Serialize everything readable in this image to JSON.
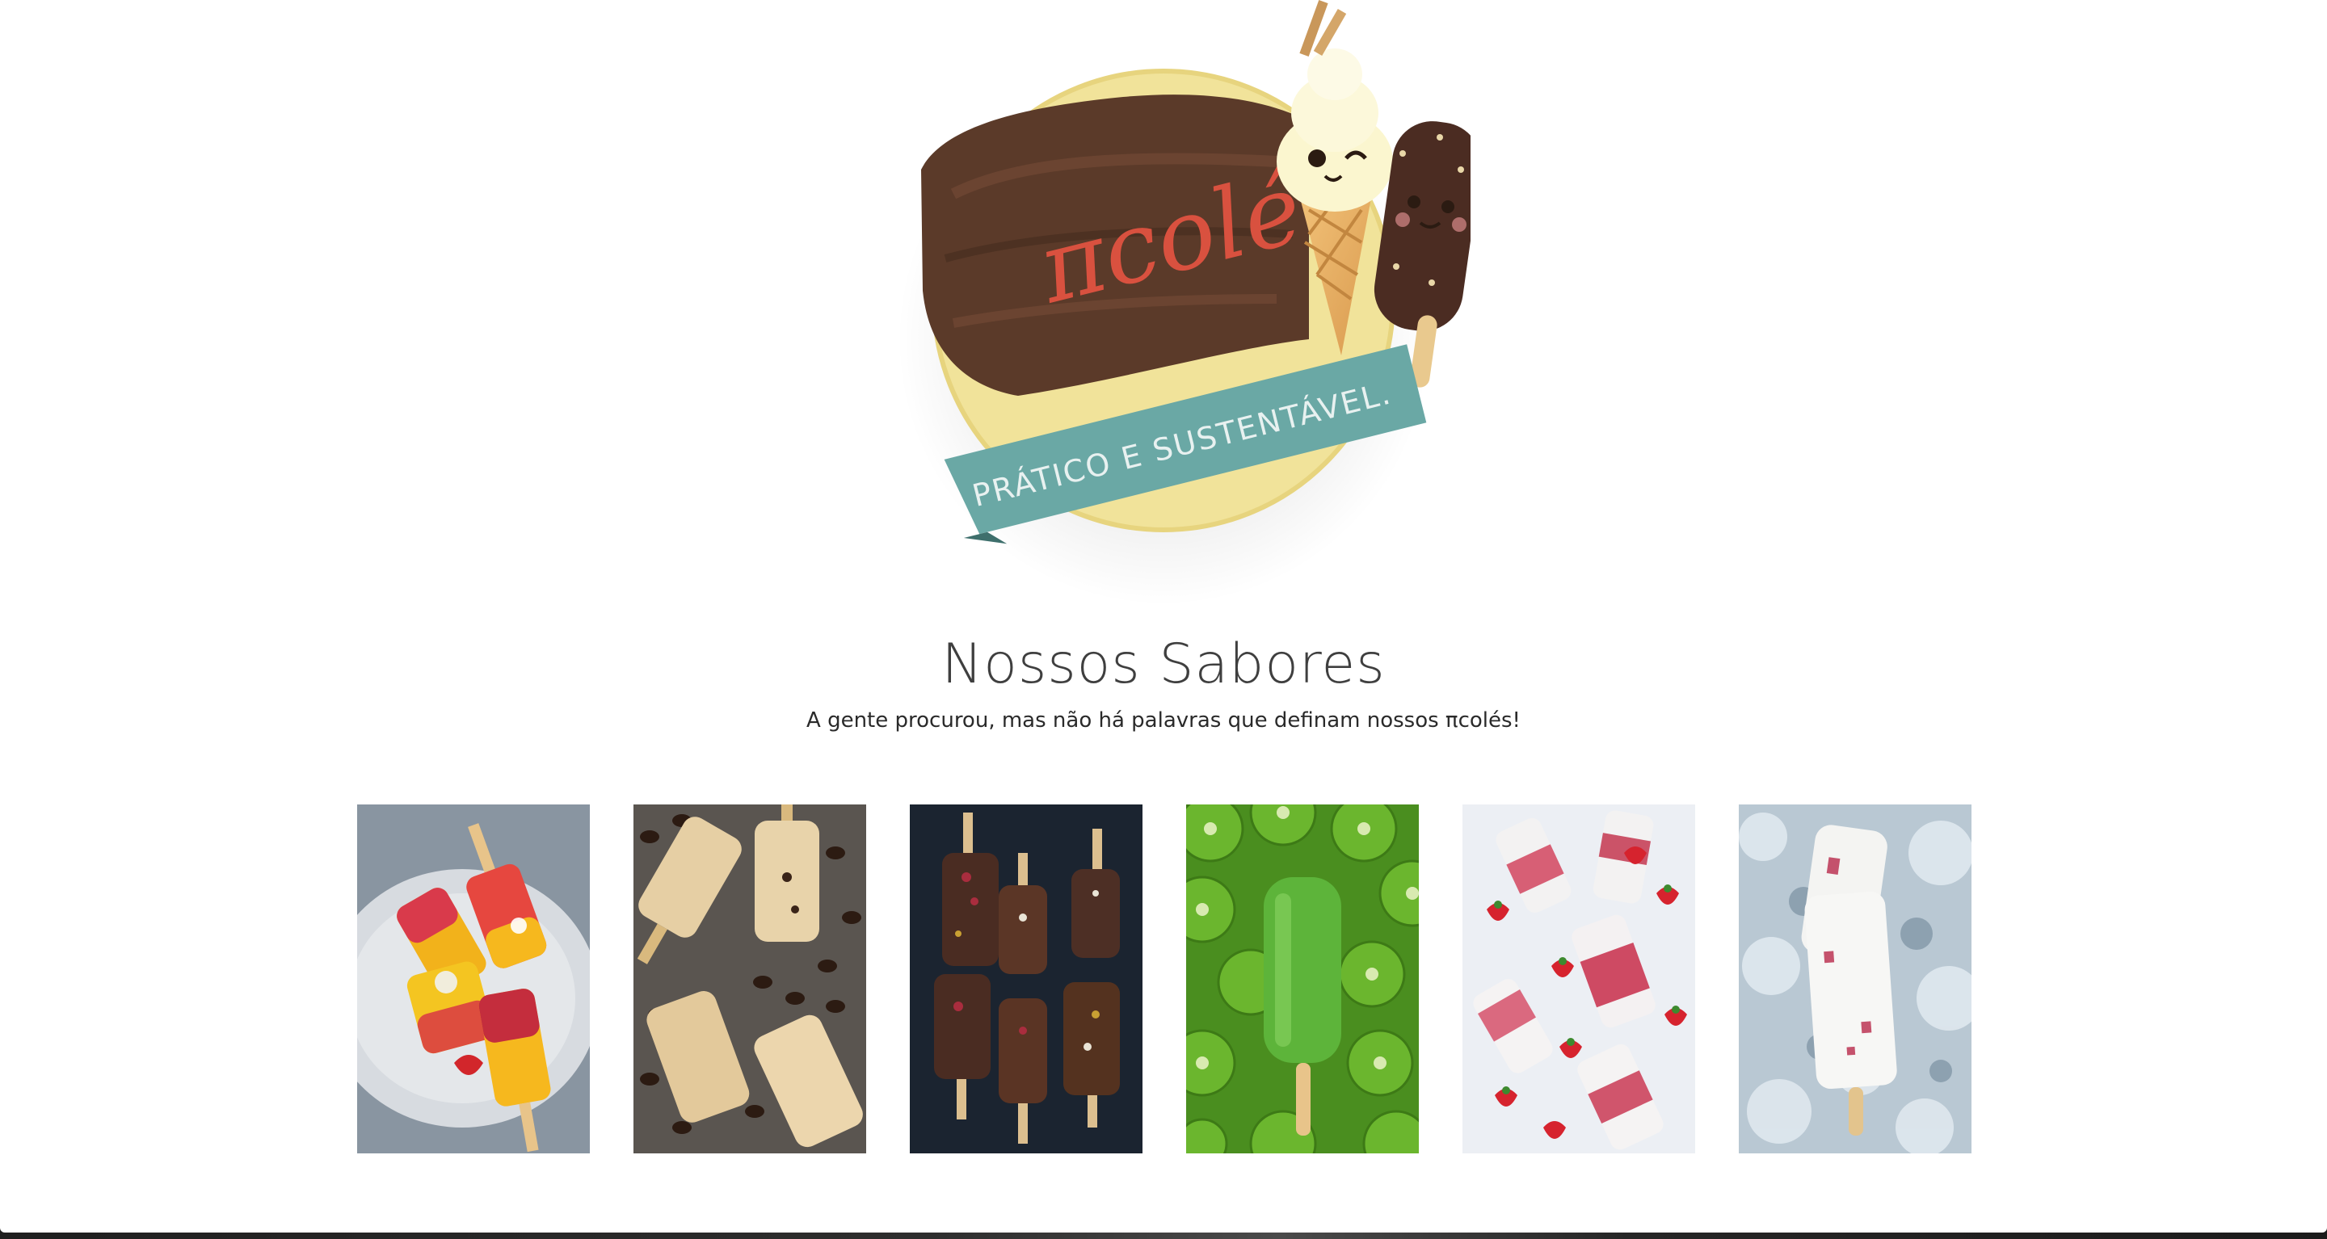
{
  "hero": {
    "logo_text": "πcolé",
    "logo_tagline": "PRÁTICO E SUSTENTÁVEL."
  },
  "flavors_section": {
    "title": "Nossos Sabores",
    "subtitle": "A gente procurou, mas não há palavras que definam nossos πcolés!",
    "photos": [
      {
        "name": "fruit-popsicles-on-plate-photo",
        "icon": "mango-raspberry-popsicles"
      },
      {
        "name": "coffee-popsicles-photo",
        "icon": "coffee-cream-popsicles"
      },
      {
        "name": "chocolate-popsicles-photo",
        "icon": "chocolate-dipped-popsicles"
      },
      {
        "name": "kiwi-popsicle-photo",
        "icon": "kiwi-popsicle"
      },
      {
        "name": "strawberry-popsicles-photo",
        "icon": "strawberry-cream-popsicles"
      },
      {
        "name": "ice-cream-popsicle-on-ice-photo",
        "icon": "berry-yogurt-popsicle"
      }
    ]
  },
  "colors": {
    "logo_teal": "#6aa8a5",
    "logo_red": "#d9513f",
    "logo_chocolate": "#5b3a29",
    "logo_yellow": "#f1e39a"
  }
}
